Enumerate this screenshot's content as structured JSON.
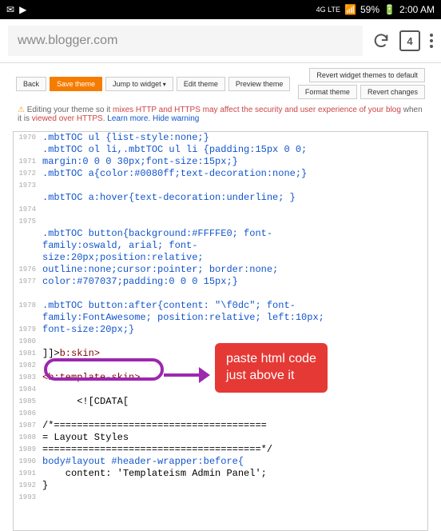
{
  "statusbar": {
    "network": "4G LTE",
    "battery": "59%",
    "time": "2:00 AM"
  },
  "browser": {
    "url": "www.blogger.com",
    "tab_count": "4"
  },
  "toolbar": {
    "back": "Back",
    "save": "Save theme",
    "jump": "Jump to widget",
    "edit": "Edit theme",
    "preview": "Preview theme",
    "revert_widget": "Revert widget themes to default",
    "format": "Format theme",
    "revert_changes": "Revert changes"
  },
  "warning": {
    "icon": "⚠",
    "pre": "Editing your theme so it",
    "mid": "mixes HTTP and HTTPS may affect the security and user experience of your blog",
    "post": "when it is",
    "viewed": "viewed over HTTPS.",
    "learn": "Learn more.",
    "hide": "Hide warning"
  },
  "callout": {
    "line1": "paste html code",
    "line2": "just above it"
  },
  "lines": [
    {
      "n": "1970",
      "t": ".mbtTOC ul {list-style:none;}"
    },
    {
      "n": "",
      "t": ".mbtTOC ol li,.mbtTOC ul li {padding:15px 0 0;"
    },
    {
      "n": "1971",
      "t": "margin:0 0 0 30px;font-size:15px;}"
    },
    {
      "n": "1972",
      "t": ".mbtTOC a{color:#0080ff;text-decoration:none;}"
    },
    {
      "n": "1973",
      "t": ""
    },
    {
      "n": "",
      "t": ".mbtTOC a:hover{text-decoration:underline; }"
    },
    {
      "n": "1974",
      "t": ""
    },
    {
      "n": "1975",
      "t": ""
    },
    {
      "n": "",
      "t": ".mbtTOC button{background:#FFFFE0; font-"
    },
    {
      "n": "",
      "t": "family:oswald, arial; font-"
    },
    {
      "n": "",
      "t": "size:20px;position:relative;"
    },
    {
      "n": "1976",
      "t": "outline:none;cursor:pointer; border:none;"
    },
    {
      "n": "1977",
      "t": "color:#707037;padding:0 0 0 15px;}"
    },
    {
      "n": "",
      "t": ""
    },
    {
      "n": "1978",
      "t": ".mbtTOC button:after{content: \"\\f0dc\"; font-"
    },
    {
      "n": "",
      "t": "family:FontAwesome; position:relative; left:10px;"
    },
    {
      "n": "1979",
      "t": "font-size:20px;}"
    },
    {
      "n": "1980",
      "t": ""
    },
    {
      "n": "1981",
      "t": "SKIN"
    },
    {
      "n": "1982",
      "t": ""
    },
    {
      "n": "1983",
      "t": "<b:template-skin>",
      "red": true
    },
    {
      "n": "1984",
      "t": ""
    },
    {
      "n": "1985",
      "t": "      <![CDATA[",
      "black": true
    },
    {
      "n": "1986",
      "t": ""
    },
    {
      "n": "1987",
      "t": "/*=====================================",
      "black": true
    },
    {
      "n": "1988",
      "t": "= Layout Styles",
      "black": true
    },
    {
      "n": "1989",
      "t": "======================================*/",
      "black": true
    },
    {
      "n": "1990",
      "t": "body#layout #header-wrapper:before{"
    },
    {
      "n": "1991",
      "t": "    content: 'Templateism Admin Panel';",
      "black": true
    },
    {
      "n": "1992",
      "t": "}",
      "black": true
    },
    {
      "n": "1993",
      "t": ""
    }
  ],
  "skin": {
    "prefix": "]]>",
    "open": "</",
    "tag": "b:skin",
    "close": ">"
  }
}
